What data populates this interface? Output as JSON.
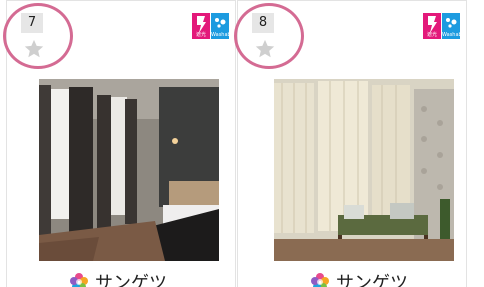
{
  "products": [
    {
      "rank": "7",
      "brand": "サンゲツ",
      "badge_pink": "遮光",
      "badge_blue": "Washable"
    },
    {
      "rank": "8",
      "brand": "サンゲツ",
      "badge_pink": "遮光",
      "badge_blue": "Washable"
    }
  ],
  "colors": {
    "rank_ring": "#d46b93",
    "badge_pink": "#e3197a",
    "badge_blue": "#1c9be0"
  }
}
